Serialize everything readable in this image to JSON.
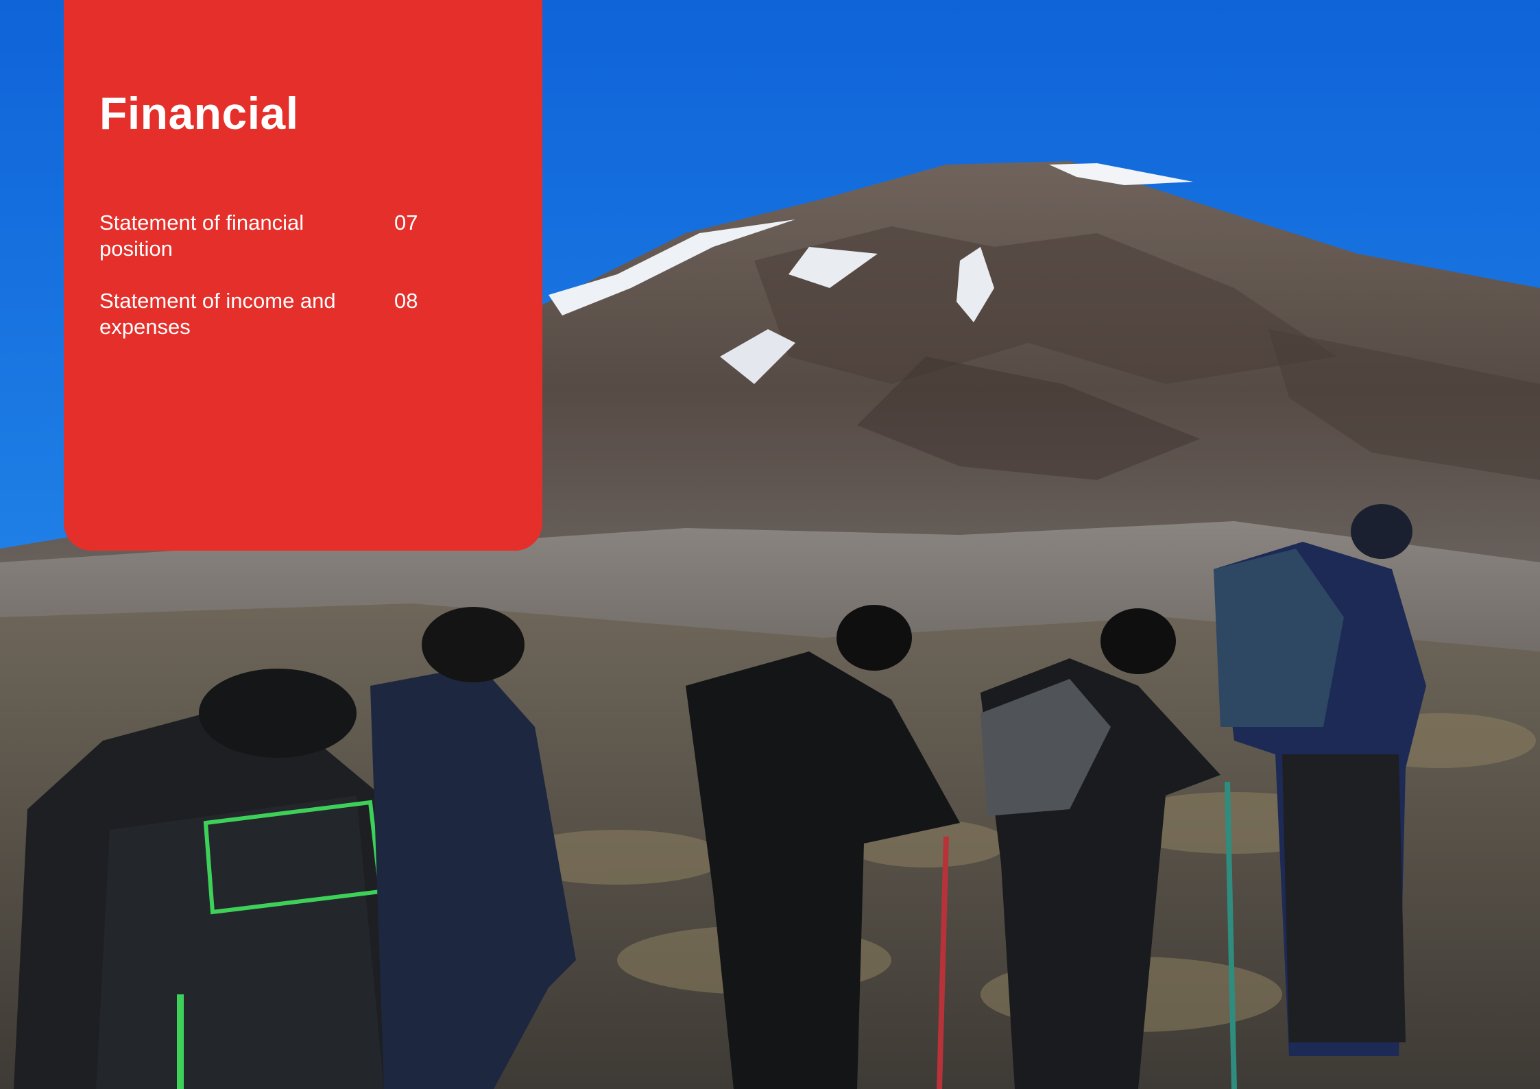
{
  "panel": {
    "title": "Financial",
    "accent_color": "#e52f2a",
    "items": [
      {
        "label": "Statement of financial position",
        "page": "07"
      },
      {
        "label": "Statement of income and expenses",
        "page": "08"
      }
    ]
  },
  "photo": {
    "icon": "mountain-hikers-photo"
  }
}
